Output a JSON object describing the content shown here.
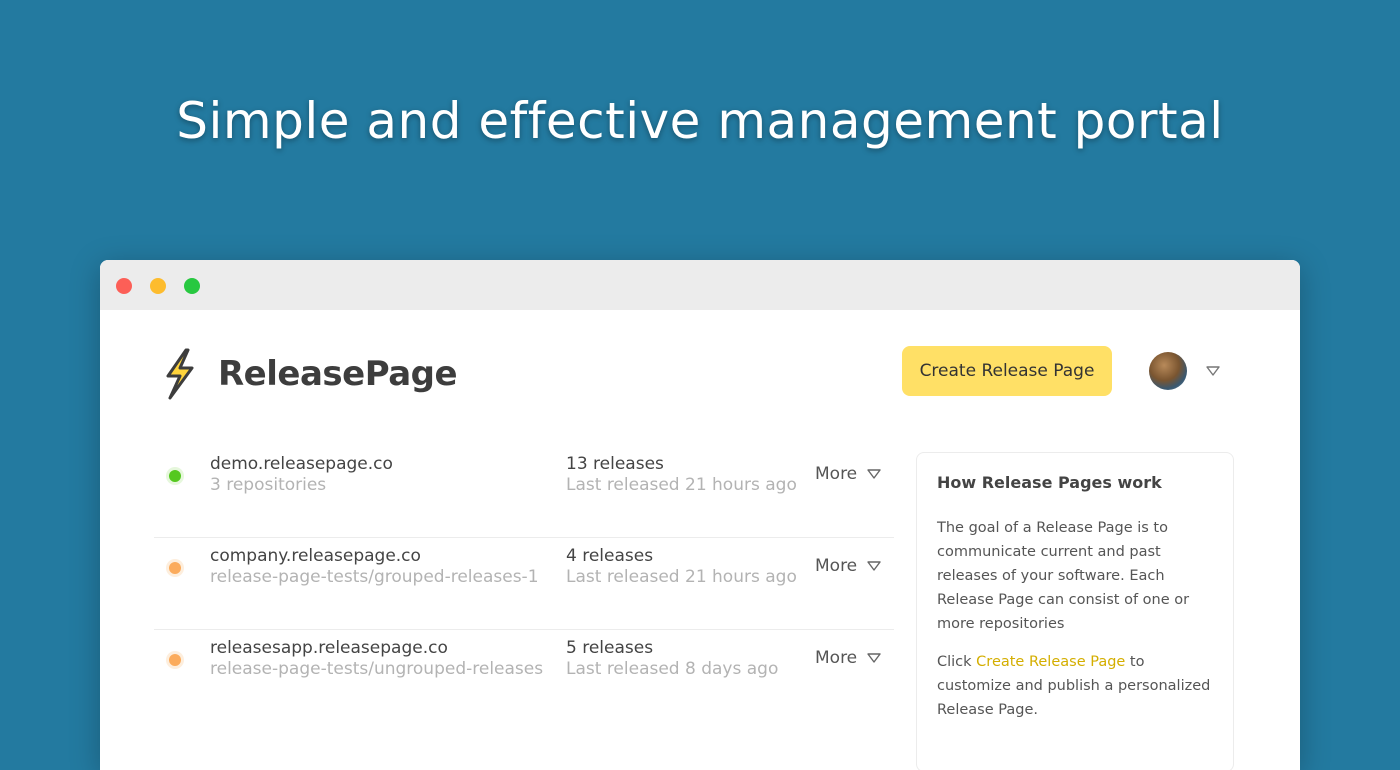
{
  "hero": {
    "title": "Simple and effective management portal"
  },
  "app": {
    "logo_text": "ReleasePage",
    "create_button": "Create Release Page"
  },
  "pages": [
    {
      "name": "demo.releasepage.co",
      "sub": "3 repositories",
      "count": "13 releases",
      "last": "Last released 21 hours ago",
      "status": "green",
      "more": "More"
    },
    {
      "name": "company.releasepage.co",
      "sub": "release-page-tests/grouped-releases-1",
      "count": "4 releases",
      "last": "Last released 21 hours ago",
      "status": "orange",
      "more": "More"
    },
    {
      "name": "releasesapp.releasepage.co",
      "sub": "release-page-tests/ungrouped-releases",
      "count": "5 releases",
      "last": "Last released 8 days ago",
      "status": "orange",
      "more": "More"
    }
  ],
  "sidebar": {
    "title": "How Release Pages work",
    "paragraph1": "The goal of a Release Page is to communicate current and past releases of your software. Each Release Page can consist of one or more repositories",
    "p2_prefix": "Click ",
    "p2_link": "Create Release Page",
    "p2_suffix": " to customize and publish a personalized Release Page."
  },
  "colors": {
    "background": "#237aa0",
    "accent_button": "#ffe066",
    "status_green": "#55c81f",
    "status_orange": "#fbab5c",
    "link": "#d4ae00"
  }
}
